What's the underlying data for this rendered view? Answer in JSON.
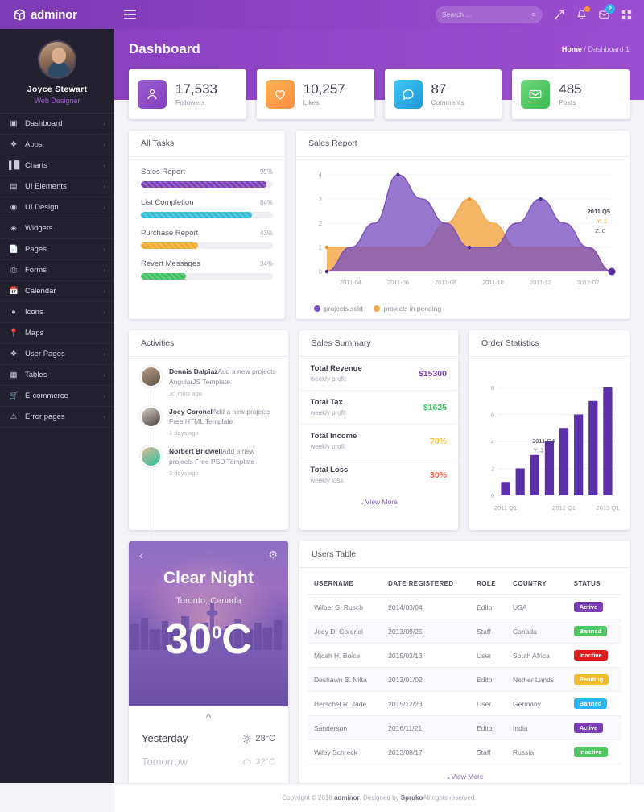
{
  "header": {
    "brand": "adminor",
    "menu_icon": "hamburger-icon",
    "search_placeholder": "Search ...",
    "search_value": "",
    "icons": [
      "expand-icon",
      "bell-icon",
      "message-icon",
      "grid-icon"
    ],
    "message_badge": "2"
  },
  "sidebar": {
    "profile": {
      "name": "Joyce Stewart",
      "role": "Web Designer"
    },
    "items": [
      {
        "label": "Dashboard",
        "icon": "monitor-icon",
        "arrow": "›"
      },
      {
        "label": "Apps",
        "icon": "apps-icon",
        "arrow": "›"
      },
      {
        "label": "Charts",
        "icon": "chart-icon",
        "arrow": "›"
      },
      {
        "label": "UI Elements",
        "icon": "layers-icon",
        "arrow": "›"
      },
      {
        "label": "UI Design",
        "icon": "design-icon",
        "arrow": "›"
      },
      {
        "label": "Widgets",
        "icon": "widgets-icon",
        "arrow": ""
      },
      {
        "label": "Pages",
        "icon": "page-icon",
        "arrow": "›"
      },
      {
        "label": "Forms",
        "icon": "forms-icon",
        "arrow": "›"
      },
      {
        "label": "Calendar",
        "icon": "calendar-icon",
        "arrow": "›"
      },
      {
        "label": "Icons",
        "icon": "icons-icon",
        "arrow": "›"
      },
      {
        "label": "Maps",
        "icon": "map-pin-icon",
        "arrow": ""
      },
      {
        "label": "User Pages",
        "icon": "user-pages-icon",
        "arrow": "›"
      },
      {
        "label": "Tables",
        "icon": "table-icon",
        "arrow": "›"
      },
      {
        "label": "E-commerce",
        "icon": "cart-icon",
        "arrow": "›"
      },
      {
        "label": "Error pages",
        "icon": "warning-icon",
        "arrow": "›"
      }
    ]
  },
  "page": {
    "title": "Dashboard",
    "breadcrumb_home": "Home",
    "breadcrumb_sep": "/",
    "breadcrumb_current": "Dashboard 1"
  },
  "stats": [
    {
      "value": "17,533",
      "label": "Followers",
      "icon": "user-icon",
      "color": "#8f4dc8"
    },
    {
      "value": "10,257",
      "label": "Likes",
      "icon": "heart-icon",
      "color": "#fb9a43"
    },
    {
      "value": "87",
      "label": "Comments",
      "icon": "comment-icon",
      "color": "#32b8e8"
    },
    {
      "value": "485",
      "label": "Posts",
      "icon": "envelope-icon",
      "color": "#4fc863"
    }
  ],
  "tasks": {
    "title": "All Tasks",
    "items": [
      {
        "name": "Sales Report",
        "pct": "95%",
        "value": 95,
        "color": "#7a3fb5"
      },
      {
        "name": "List Completion",
        "pct": "84%",
        "value": 84,
        "color": "#2fbcd4"
      },
      {
        "name": "Purchase Report",
        "pct": "43%",
        "value": 43,
        "color": "#f0a92e"
      },
      {
        "name": "Revert Messages",
        "pct": "34%",
        "value": 34,
        "color": "#3fbf5f"
      }
    ]
  },
  "sales_report": {
    "title": "Sales Report"
  },
  "activities": {
    "title": "Activities",
    "items": [
      {
        "name": "Dennis Dalpiaz",
        "text": "Add a new projects AngularJS Template",
        "time": "30 mins ago"
      },
      {
        "name": "Joey Coronel",
        "text": "Add a new projects Free HTML Template",
        "time": "1 days ago"
      },
      {
        "name": "Norbert Bridwell",
        "text": "Add a new projects Free PSD Template",
        "time": "3 days ago"
      }
    ]
  },
  "sales_summary": {
    "title": "Sales Summary",
    "view_more": "⌄View More",
    "rows": [
      {
        "title": "Total Revenue",
        "sub": "weekly profit",
        "value": "$15300",
        "color": "#7a3fb5"
      },
      {
        "title": "Total Tax",
        "sub": "weekly profit",
        "value": "$1625",
        "color": "#3fc963"
      },
      {
        "title": "Total Income",
        "sub": "weekly profit",
        "value": "70%",
        "color": "#f5c342"
      },
      {
        "title": "Total Loss",
        "sub": "weekly loss",
        "value": "30%",
        "color": "#f0644b"
      }
    ]
  },
  "order_statistics": {
    "title": "Order Statistics"
  },
  "weather": {
    "condition": "Clear Night",
    "location": "Toronto, Canada",
    "temp": "30",
    "degree": "0",
    "unit": "C",
    "back_icon": "chevron-left-icon",
    "settings_icon": "gear-icon",
    "caret_icon": "chevron-up-icon",
    "days": [
      {
        "label": "Yesterday",
        "temp": "28°C",
        "icon": "sun-icon",
        "dim": false
      },
      {
        "label": "Tomorrow",
        "temp": "32°C",
        "icon": "cloud-icon",
        "dim": true
      }
    ]
  },
  "users_table": {
    "title": "Users Table",
    "view_more": "⌄View More",
    "columns": [
      "USERNAME",
      "DATE REGISTERED",
      "ROLE",
      "COUNTRY",
      "STATUS"
    ],
    "rows": [
      {
        "username": "Wilber S. Rusch",
        "date": "2014/03/04",
        "role": "Editor",
        "country": "USA",
        "status": "Active",
        "status_color": "#7a3fb5"
      },
      {
        "username": "Joey D. Coronel",
        "date": "2013/09/25",
        "role": "Staff",
        "country": "Canada",
        "status": "Banned",
        "status_color": "#4fc863"
      },
      {
        "username": "Micah H. Boice",
        "date": "2015/02/13",
        "role": "User",
        "country": "South Africa",
        "status": "Inactive",
        "status_color": "#e01b1b"
      },
      {
        "username": "Deshawn B. Nitta",
        "date": "2013/01/02",
        "role": "Editor",
        "country": "Nether Lands",
        "status": "Pending",
        "status_color": "#f5bb2e"
      },
      {
        "username": "Herschel R. Jade",
        "date": "2015/12/23",
        "role": "User",
        "country": "Germany",
        "status": "Banned",
        "status_color": "#29b6f6"
      },
      {
        "username": "Sanderson",
        "date": "2016/11/21",
        "role": "Editor",
        "country": "India",
        "status": "Active",
        "status_color": "#7a3fb5"
      },
      {
        "username": "Wiley Schreck",
        "date": "2013/08/17",
        "role": "Staff",
        "country": "Russia",
        "status": "Inactive",
        "status_color": "#4fc863"
      }
    ]
  },
  "footer": {
    "pre": "Copyright © 2018 ",
    "brand": "adminor",
    "mid": ". Designed by ",
    "designer": "Spruko",
    "post": "All rights reserved."
  },
  "chart_data": [
    {
      "type": "area",
      "title": "Sales Report",
      "x": [
        "2011-03",
        "2011-04",
        "2011-05",
        "2011-06",
        "2011-07",
        "2011-08",
        "2011-09",
        "2011-10",
        "2011-11",
        "2011-12",
        "2012-01",
        "2012-02",
        "2012-03"
      ],
      "xlabel": "",
      "ylabel": "",
      "ylim": [
        0,
        4
      ],
      "yticks": [
        0,
        1,
        2,
        3,
        4
      ],
      "xticks": [
        "2011-04",
        "2011-06",
        "2011-08",
        "2011-10",
        "2011-12",
        "2012-02"
      ],
      "grid": true,
      "legend": "bottom-left",
      "series": [
        {
          "name": "projects sold",
          "color": "#7a52c0",
          "values": [
            0,
            1,
            2,
            4,
            3,
            2,
            1,
            1,
            2,
            3,
            2,
            1,
            0
          ]
        },
        {
          "name": "projects in pending",
          "color": "#f2a84b",
          "values": [
            1,
            1,
            1,
            1,
            1,
            2,
            3,
            2,
            1,
            1,
            1,
            1,
            0
          ]
        }
      ],
      "tooltip": {
        "label": "2011 Q5",
        "y": "Y: 1",
        "z": "Z: 0"
      }
    },
    {
      "type": "bar",
      "title": "Order Statistics",
      "categories": [
        "2011 Q1",
        "2011 Q2",
        "2011 Q3",
        "2011 Q4",
        "2012 Q1",
        "2012 Q2",
        "2012 Q3",
        "2013 Q1"
      ],
      "values": [
        1,
        2,
        3,
        4,
        5,
        6,
        7,
        8
      ],
      "xlabel": "",
      "ylabel": "",
      "ylim": [
        0,
        8
      ],
      "yticks": [
        0,
        2,
        4,
        6,
        8
      ],
      "xticks": [
        "2011 Q1",
        "2012 Q1",
        "2013 Q1"
      ],
      "grid": true,
      "color": "#5b2fa8",
      "tooltip": {
        "label": "2011 Q4",
        "y": "Y: 3"
      }
    }
  ]
}
